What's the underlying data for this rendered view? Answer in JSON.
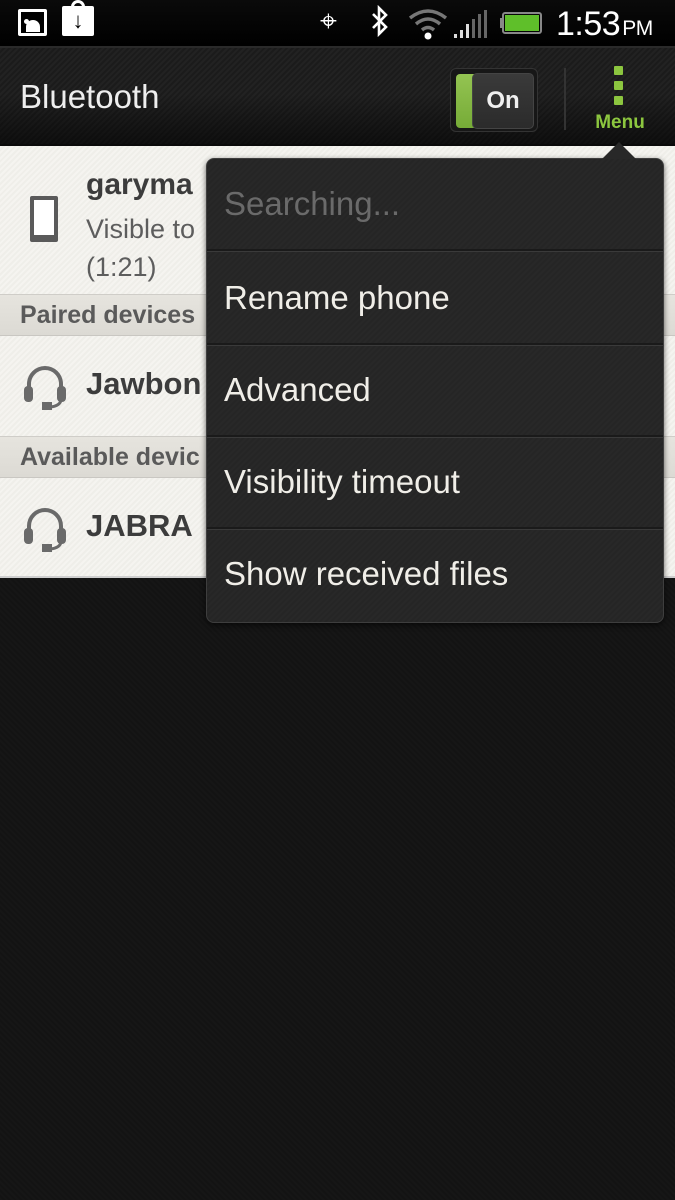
{
  "status_bar": {
    "time": "1:53",
    "ampm": "PM",
    "icons": [
      "gallery-icon",
      "store-download-icon",
      "gps-icon",
      "bluetooth-icon",
      "wifi-icon",
      "signal-icon",
      "battery-icon"
    ],
    "gps_glyph": "⌖",
    "bt_glyph": "ᛒ"
  },
  "action_bar": {
    "title": "Bluetooth",
    "toggle": {
      "label": "On",
      "state": true
    },
    "menu_label": "Menu"
  },
  "my_device": {
    "name": "garyma",
    "subtitle": "Visible to",
    "timer": "(1:21)"
  },
  "sections": {
    "paired": {
      "header": "Paired devices",
      "devices": [
        {
          "name": "Jawbon"
        }
      ]
    },
    "available": {
      "header": "Available devic",
      "devices": [
        {
          "name": "JABRA"
        }
      ]
    }
  },
  "popup_menu": {
    "items": [
      {
        "label": "Searching...",
        "enabled": false
      },
      {
        "label": "Rename phone",
        "enabled": true
      },
      {
        "label": "Advanced",
        "enabled": true
      },
      {
        "label": "Visibility timeout",
        "enabled": true
      },
      {
        "label": "Show received files",
        "enabled": true
      }
    ]
  },
  "colors": {
    "accent_green": "#8cc63f",
    "action_bar_bg": "#1e1e1e",
    "list_bg": "#f3f2ee",
    "popup_bg": "#272727"
  }
}
